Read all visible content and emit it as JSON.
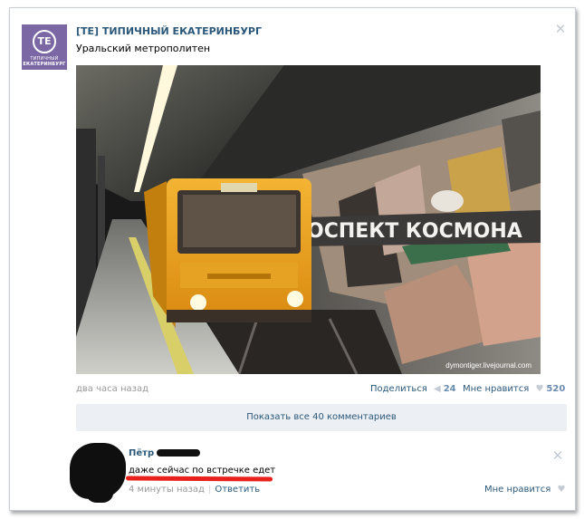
{
  "post": {
    "community_name": "[ТЕ] ТИПИЧНЫЙ ЕКАТЕРИНБУРГ",
    "avatar": {
      "monogram": "ТЕ",
      "caption_line1": "ТИПИЧНЫЙ",
      "caption_line2": "ЕКАТЕРИНБУРГ"
    },
    "text": "Уральский метрополитен",
    "photo": {
      "station_sign": "ОСПЕКТ КОСМОНА",
      "watermark": "dymontiger.livejournal.com"
    },
    "time": "два часа назад",
    "share_label": "Поделиться",
    "share_count": "24",
    "like_label": "Мне нравится",
    "like_count": "520",
    "show_comments": "Показать все 40 комментариев",
    "close_glyph": "✕"
  },
  "comment": {
    "author_first_name": "Пётр",
    "text": "даже сейчас по встречке едет",
    "time": "4 минуты назад",
    "reply_label": "Ответить",
    "like_label": "Мне нравится",
    "close_glyph": "✕"
  },
  "icons": {
    "share": "megaphone-icon",
    "like": "heart-icon"
  },
  "colors": {
    "link": "#2b587a",
    "avatar_bg": "#7a67a3",
    "underline": "#e8211c",
    "show_comments_bg": "#eceff3"
  }
}
